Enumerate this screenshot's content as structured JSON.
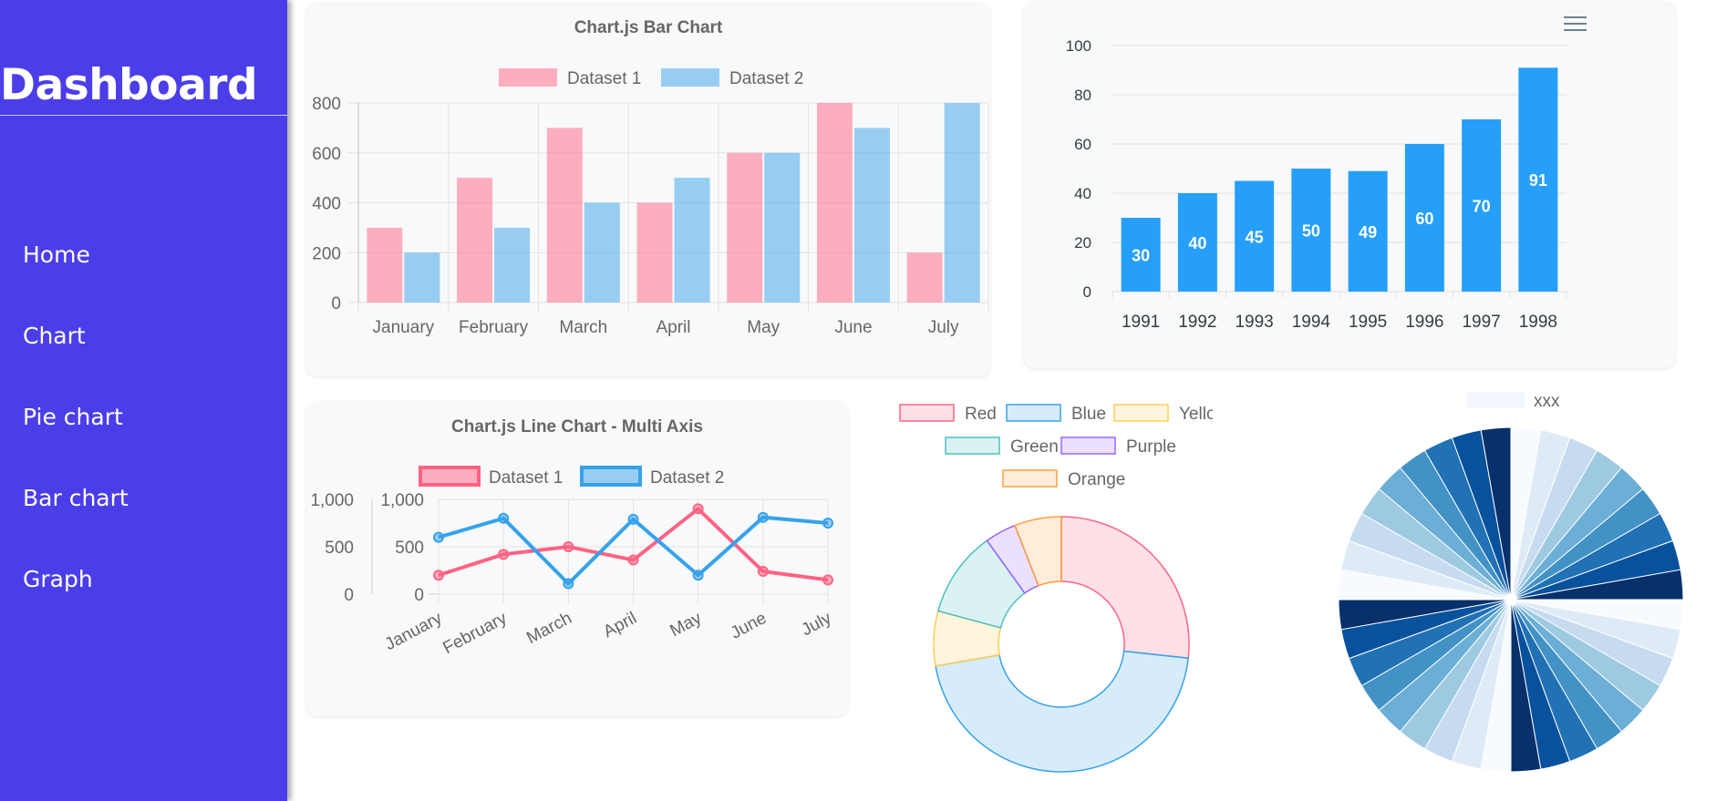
{
  "sidebar": {
    "title": "Dashboard",
    "items": [
      {
        "label": "Home"
      },
      {
        "label": "Chart"
      },
      {
        "label": "Pie chart"
      },
      {
        "label": "Bar chart"
      },
      {
        "label": "Graph"
      }
    ]
  },
  "toolbar": {
    "menu_icon": "hamburger-menu-icon"
  },
  "colors": {
    "sidebar_bg": "#4b3ee9",
    "pink": "#ff6384",
    "blue": "#36a2eb",
    "apex_blue": "#269ffb"
  },
  "chart_data": [
    {
      "type": "bar",
      "title": "Chart.js Bar Chart",
      "categories": [
        "January",
        "February",
        "March",
        "April",
        "May",
        "June",
        "July"
      ],
      "series": [
        {
          "name": "Dataset 1",
          "values": [
            300,
            500,
            700,
            400,
            600,
            800,
            200
          ]
        },
        {
          "name": "Dataset 2",
          "values": [
            200,
            300,
            400,
            500,
            600,
            700,
            800
          ]
        }
      ],
      "ylim": [
        0,
        800
      ],
      "yticks": [
        "0",
        "200",
        "400",
        "600",
        "800"
      ],
      "grid": true,
      "legend": "top"
    },
    {
      "type": "bar",
      "categories": [
        "1991",
        "1992",
        "1993",
        "1994",
        "1995",
        "1996",
        "1997",
        "1998"
      ],
      "values": [
        30,
        40,
        45,
        50,
        49,
        60,
        70,
        91
      ],
      "data_labels": true,
      "ylim": [
        0,
        100
      ],
      "yticks": [
        "0",
        "20",
        "40",
        "60",
        "80",
        "100"
      ],
      "grid": true
    },
    {
      "type": "line",
      "title": "Chart.js Line Chart - Multi Axis",
      "categories": [
        "January",
        "February",
        "March",
        "April",
        "May",
        "June",
        "July"
      ],
      "series": [
        {
          "name": "Dataset 1",
          "values": [
            200,
            420,
            500,
            360,
            900,
            240,
            150
          ]
        },
        {
          "name": "Dataset 2",
          "values": [
            600,
            800,
            110,
            790,
            200,
            810,
            750
          ]
        }
      ],
      "ylim": [
        0,
        1000
      ],
      "yticks": [
        "0",
        "500",
        "1,000"
      ],
      "grid": true,
      "legend": "top"
    },
    {
      "type": "pie",
      "subtype": "doughnut",
      "labels": [
        "Red",
        "Blue",
        "Yellow",
        "Green",
        "Purple",
        "Orange"
      ],
      "values": [
        27,
        46,
        7,
        11,
        4,
        6
      ],
      "colors": [
        "#ff6384",
        "#36a2eb",
        "#ffce56",
        "#4bc0c0",
        "#9966ff",
        "#ff9f40"
      ],
      "legend": "top"
    },
    {
      "type": "pie",
      "legend_label": "xxx",
      "palette": "blues",
      "slice_count": 36,
      "values": [
        1,
        1,
        1,
        1,
        1,
        1,
        1,
        1,
        1,
        1,
        1,
        1,
        1,
        1,
        1,
        1,
        1,
        1,
        1,
        1,
        1,
        1,
        1,
        1,
        1,
        1,
        1,
        1,
        1,
        1,
        1,
        1,
        1,
        1,
        1,
        1
      ],
      "legend": "top"
    }
  ]
}
